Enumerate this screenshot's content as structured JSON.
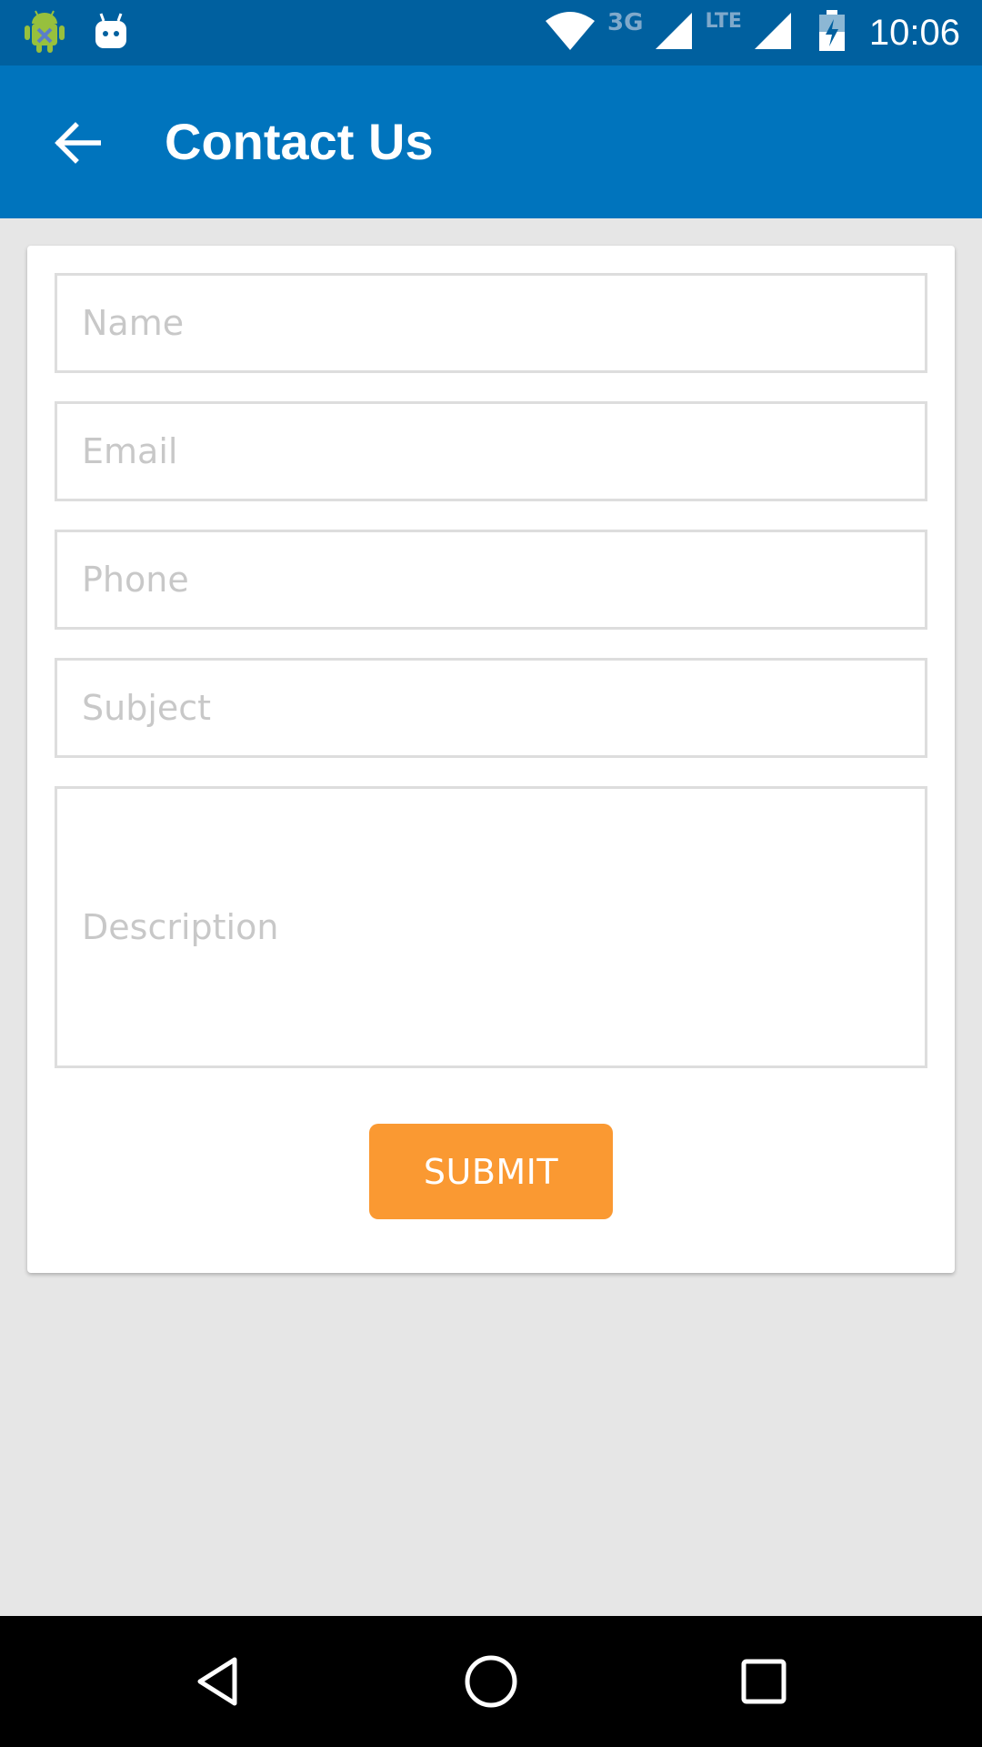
{
  "status_bar": {
    "time": "10:06",
    "network_labels": [
      "3G",
      "LTE"
    ],
    "icons": [
      "android-debug-icon",
      "notification-bot-icon",
      "wifi-icon",
      "signal-icon",
      "battery-charging-icon"
    ]
  },
  "app_bar": {
    "title": "Contact Us",
    "background_color": "#0074bd"
  },
  "form": {
    "fields": [
      {
        "name": "name",
        "placeholder": "Name",
        "value": ""
      },
      {
        "name": "email",
        "placeholder": "Email",
        "value": ""
      },
      {
        "name": "phone",
        "placeholder": "Phone",
        "value": ""
      },
      {
        "name": "subject",
        "placeholder": "Subject",
        "value": ""
      },
      {
        "name": "description",
        "placeholder": "Description",
        "value": ""
      }
    ],
    "submit_label": "SUBMIT",
    "submit_color": "#fa9932"
  },
  "nav_bar": {
    "icons": [
      "back-triangle-icon",
      "home-circle-icon",
      "recents-square-icon"
    ]
  }
}
